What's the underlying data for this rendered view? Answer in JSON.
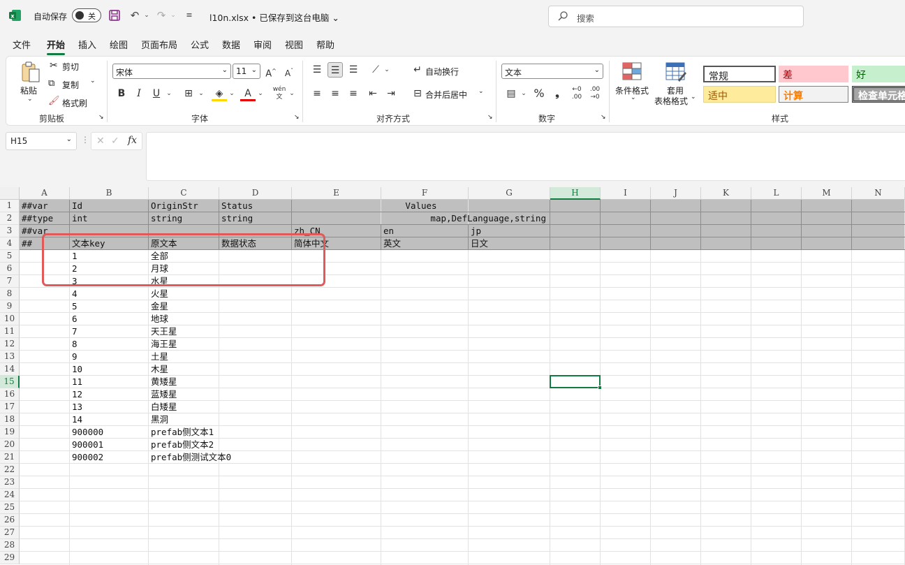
{
  "titlebar": {
    "autosave_label": "自动保存",
    "autosave_state": "关",
    "filename": "l10n.xlsx • 已保存到这台电脑",
    "search_placeholder": "搜索"
  },
  "menu": [
    "文件",
    "开始",
    "插入",
    "绘图",
    "页面布局",
    "公式",
    "数据",
    "审阅",
    "视图",
    "帮助"
  ],
  "menu_active": "开始",
  "ribbon": {
    "clipboard": {
      "paste": "粘贴",
      "cut": "剪切",
      "copy": "复制",
      "format_painter": "格式刷",
      "label": "剪贴板"
    },
    "font": {
      "name": "宋体",
      "size": "11",
      "label": "字体"
    },
    "alignment": {
      "wrap": "自动换行",
      "merge": "合并后居中",
      "label": "对齐方式"
    },
    "number": {
      "format": "文本",
      "label": "数字"
    },
    "styles": {
      "cond_format": "条件格式",
      "table_format_1": "套用",
      "table_format_2": "表格格式",
      "label": "样式",
      "cells": [
        {
          "text": "常规",
          "bg": "#ffffff",
          "color": "#000000"
        },
        {
          "text": "差",
          "bg": "#ffc7ce",
          "color": "#9c0006"
        },
        {
          "text": "好",
          "bg": "#c6efce",
          "color": "#006100"
        },
        {
          "text": "适中",
          "bg": "#ffeb9c",
          "color": "#9c5700"
        },
        {
          "text": "计算",
          "bg": "#f2f2f2",
          "color": "#fa7d00"
        },
        {
          "text": "检查单元格",
          "bg": "#a5a5a5",
          "color": "#ffffff"
        }
      ]
    }
  },
  "formula_bar": {
    "name_box": "H15",
    "fx": "fx",
    "content": ""
  },
  "columns": [
    "A",
    "B",
    "C",
    "D",
    "E",
    "F",
    "G",
    "H",
    "I",
    "J",
    "K",
    "L",
    "M",
    "N"
  ],
  "selected_col": "H",
  "selected_row": "15",
  "rows": [
    "1",
    "2",
    "3",
    "4",
    "5",
    "6",
    "7",
    "8",
    "9",
    "10",
    "11",
    "12",
    "13",
    "14",
    "15",
    "16",
    "17",
    "18",
    "19",
    "20",
    "21",
    "22",
    "23",
    "24",
    "25",
    "26",
    "27",
    "28",
    "29"
  ],
  "header_rows": {
    "r1": {
      "A": "##var",
      "B": "Id",
      "C": "OriginStr",
      "D": "Status",
      "values": "Values"
    },
    "r2": {
      "A": "##type",
      "B": "int",
      "C": "string",
      "D": "string",
      "values": "map,DefLanguage,string"
    },
    "r3": {
      "A": "##var",
      "E": "zh_CN",
      "F": "en",
      "G": "jp"
    },
    "r4": {
      "A": "##",
      "B": "文本key",
      "C": "原文本",
      "D": "数据状态",
      "E": "简体中文",
      "F": "英文",
      "G": "日文"
    }
  },
  "data_rows": [
    {
      "id": "1",
      "text": "全部"
    },
    {
      "id": "2",
      "text": "月球"
    },
    {
      "id": "3",
      "text": "水星"
    },
    {
      "id": "4",
      "text": "火星"
    },
    {
      "id": "5",
      "text": "金星"
    },
    {
      "id": "6",
      "text": "地球"
    },
    {
      "id": "7",
      "text": "天王星"
    },
    {
      "id": "8",
      "text": "海王星"
    },
    {
      "id": "9",
      "text": "土星"
    },
    {
      "id": "10",
      "text": "木星"
    },
    {
      "id": "11",
      "text": "黄矮星"
    },
    {
      "id": "12",
      "text": "蓝矮星"
    },
    {
      "id": "13",
      "text": "白矮星"
    },
    {
      "id": "14",
      "text": "黑洞"
    },
    {
      "id": "900000",
      "text": "prefab侧文本1"
    },
    {
      "id": "900001",
      "text": "prefab侧文本2"
    },
    {
      "id": "900002",
      "text": "prefab侧测试文本0"
    }
  ]
}
